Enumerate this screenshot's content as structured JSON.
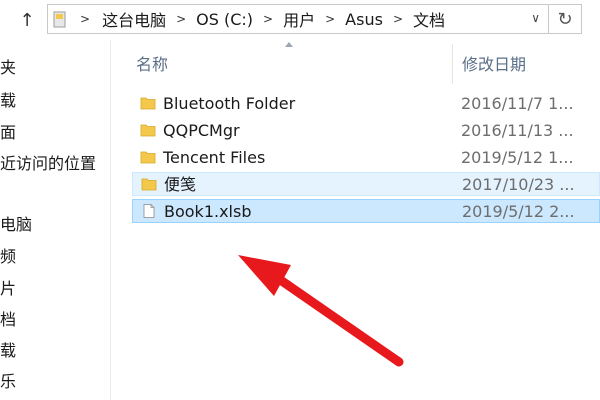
{
  "address_bar": {
    "breadcrumbs": [
      "这台电脑",
      "OS (C:)",
      "用户",
      "Asus",
      "文档"
    ]
  },
  "navigation_pane": {
    "items": [
      "夹",
      "载",
      "面",
      "近访问的位置",
      "电脑",
      "频",
      "片",
      "档",
      "载",
      "乐"
    ]
  },
  "columns": {
    "name": "名称",
    "date_modified": "修改日期"
  },
  "files": [
    {
      "name": "Bluetooth Folder",
      "date": "2016/11/7 1...",
      "type": "folder"
    },
    {
      "name": "QQPCMgr",
      "date": "2016/11/13 ...",
      "type": "folder"
    },
    {
      "name": "Tencent Files",
      "date": "2019/5/12 1...",
      "type": "folder"
    },
    {
      "name": "便笺",
      "date": "2017/10/23 ...",
      "type": "folder",
      "state": "hover"
    },
    {
      "name": "Book1.xlsb",
      "date": "2019/5/12 2...",
      "type": "file",
      "state": "selected"
    }
  ],
  "annotation": {
    "arrow_color": "#e8191c"
  },
  "colors": {
    "selection_bg": "#cce8ff",
    "hover_bg": "#e5f3ff",
    "folder": "#f3c84b",
    "header_text": "#5a6f88"
  }
}
